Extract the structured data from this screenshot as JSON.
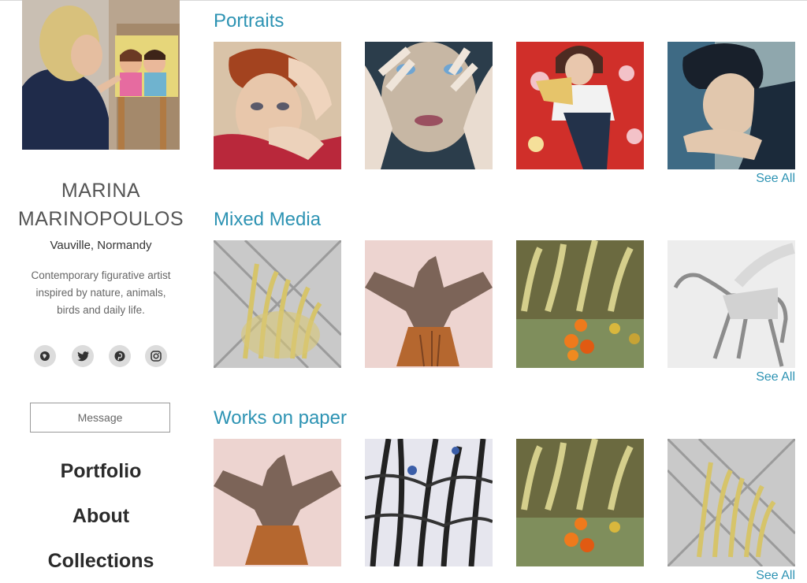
{
  "artist": {
    "name_line1": "MARINA",
    "name_line2": "MARINOPOULOS",
    "location": "Vauville, Normandy",
    "bio_line1": "Contemporary figurative artist",
    "bio_line2": "inspired by nature, animals,",
    "bio_line3": "birds and daily life."
  },
  "socials": [
    {
      "icon": "globe-icon"
    },
    {
      "icon": "twitter-icon"
    },
    {
      "icon": "pinterest-icon"
    },
    {
      "icon": "instagram-icon"
    }
  ],
  "message_button": "Message",
  "nav": {
    "items": [
      {
        "label": "Portfolio"
      },
      {
        "label": "About"
      },
      {
        "label": "Collections"
      }
    ]
  },
  "sections": [
    {
      "title": "Portraits",
      "see_all": "See All"
    },
    {
      "title": "Mixed Media",
      "see_all": "See All"
    },
    {
      "title": "Works on paper",
      "see_all": "See All"
    }
  ],
  "colors": {
    "accent": "#2d93b3",
    "text": "#444444",
    "social_bg": "#dcdcdc"
  }
}
